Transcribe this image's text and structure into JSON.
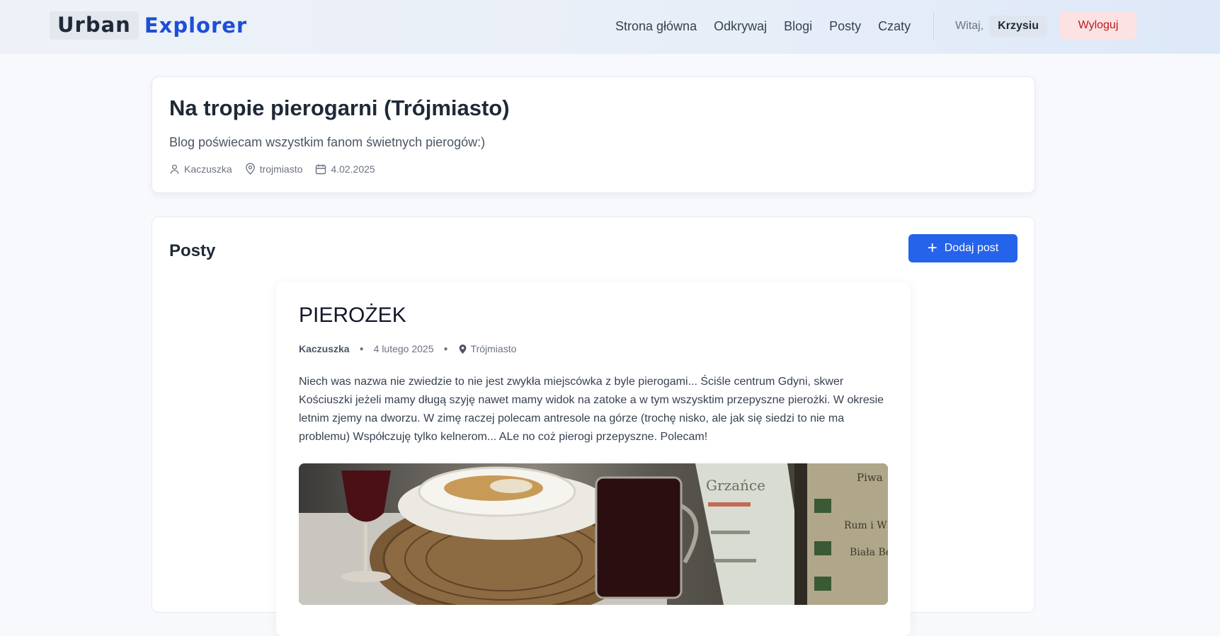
{
  "header": {
    "logo_part1": "Urban",
    "logo_part2": "Explorer",
    "nav": [
      "Strona główna",
      "Odkrywaj",
      "Blogi",
      "Posty",
      "Czaty"
    ],
    "greeting": "Witaj,",
    "username": "Krzysiu",
    "logout_label": "Wyloguj"
  },
  "blog": {
    "title": "Na tropie pierogarni (Trójmiasto)",
    "description": "Blog poświecam wszystkim fanom świetnych pierogów:)",
    "author": "Kaczuszka",
    "location": "trojmiasto",
    "date": "4.02.2025"
  },
  "posts": {
    "heading": "Posty",
    "add_label": "Dodaj post",
    "items": [
      {
        "title": "PIEROŻEK",
        "author": "Kaczuszka",
        "date": "4 lutego 2025",
        "location": "Trójmiasto",
        "body": "Niech was nazwa nie zwiedzie to nie jest zwykła miejscówka z byle pierogami... Ściśle centrum Gdyni, skwer Kościuszki jeżeli mamy długą szyję nawet mamy widok na zatoke a w tym wszysktim przepyszne pierożki. W okresie letnim zjemy na dworzu. W zimę raczej polecam antresole na górze (trochę nisko, ale jak się siedzi to nie ma problemu) Współczuję tylko kelnerom... ALe no coż pierogi przepyszne. Polecam!",
        "image_alt_text": [
          "Grzańce",
          "Piwa",
          "Rum i W",
          "Biała Bez"
        ]
      }
    ]
  },
  "colors": {
    "accent": "#2563eb",
    "logo_blue": "#1d4ed8",
    "logout_bg": "#fde2e4",
    "logout_text": "#b91c1c"
  }
}
